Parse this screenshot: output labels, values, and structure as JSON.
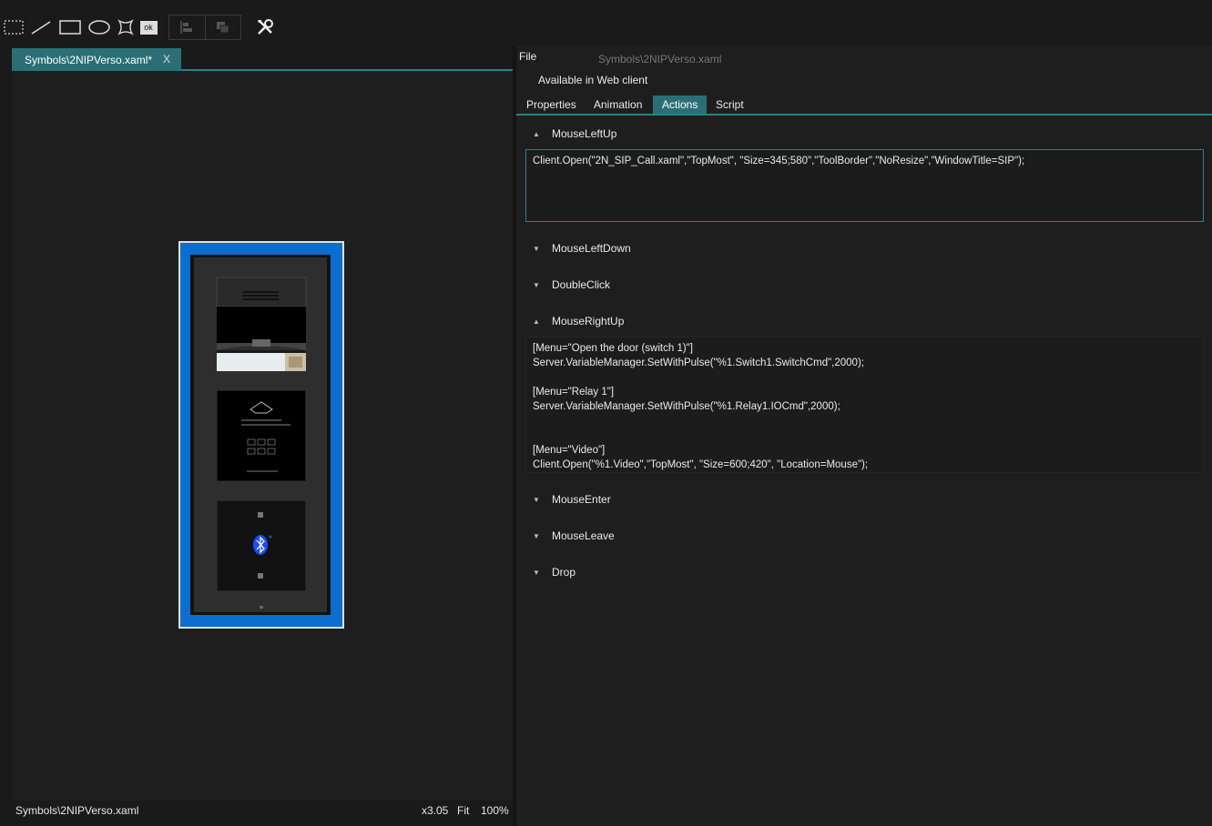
{
  "toolbar": {
    "tools": [
      {
        "name": "selection-tool-icon"
      },
      {
        "name": "line-tool-icon"
      },
      {
        "name": "rectangle-tool-icon"
      },
      {
        "name": "ellipse-tool-icon"
      },
      {
        "name": "polygon-tool-icon"
      },
      {
        "name": "button-tool-icon",
        "label": "ok"
      },
      {
        "name": "align-left-icon"
      },
      {
        "name": "arrange-icon"
      },
      {
        "name": "tools-icon"
      }
    ]
  },
  "document": {
    "tab_label": "Symbols\\2NIPVerso.xaml*",
    "tab_close": "X",
    "status_path": "Symbols\\2NIPVerso.xaml",
    "zoom_factor": "x3.05",
    "fit_label": "Fit",
    "zoom_percent": "100%"
  },
  "properties": {
    "file_label": "File",
    "file_path": "Symbols\\2NIPVerso.xaml",
    "web_client_label": "Available in Web client",
    "tabs": [
      "Properties",
      "Animation",
      "Actions",
      "Script"
    ],
    "active_tab": "Actions"
  },
  "events": {
    "mouse_left_up": {
      "label": "MouseLeftUp",
      "code": "Client.Open(\"2N_SIP_Call.xaml\",\"TopMost\", \"Size=345;580\",\"ToolBorder\",\"NoResize\",\"WindowTitle=SIP\");"
    },
    "mouse_left_down": {
      "label": "MouseLeftDown"
    },
    "double_click": {
      "label": "DoubleClick"
    },
    "mouse_right_up": {
      "label": "MouseRightUp",
      "code": "[Menu=\"Open the door (switch 1)\"]\nServer.VariableManager.SetWithPulse(\"%1.Switch1.SwitchCmd\",2000);\n\n[Menu=\"Relay 1\"]\nServer.VariableManager.SetWithPulse(\"%1.Relay1.IOCmd\",2000);\n\n\n[Menu=\"Video\"]\nClient.Open(\"%1.Video\",\"TopMost\", \"Size=600;420\", \"Location=Mouse\");"
    },
    "mouse_enter": {
      "label": "MouseEnter"
    },
    "mouse_leave": {
      "label": "MouseLeave"
    },
    "drop": {
      "label": "Drop"
    }
  },
  "colors": {
    "accent": "#2b7f88",
    "active_tab": "#2a6f76",
    "selection_frame": "#0a6fcf",
    "bluetooth": "#1a4dff"
  }
}
